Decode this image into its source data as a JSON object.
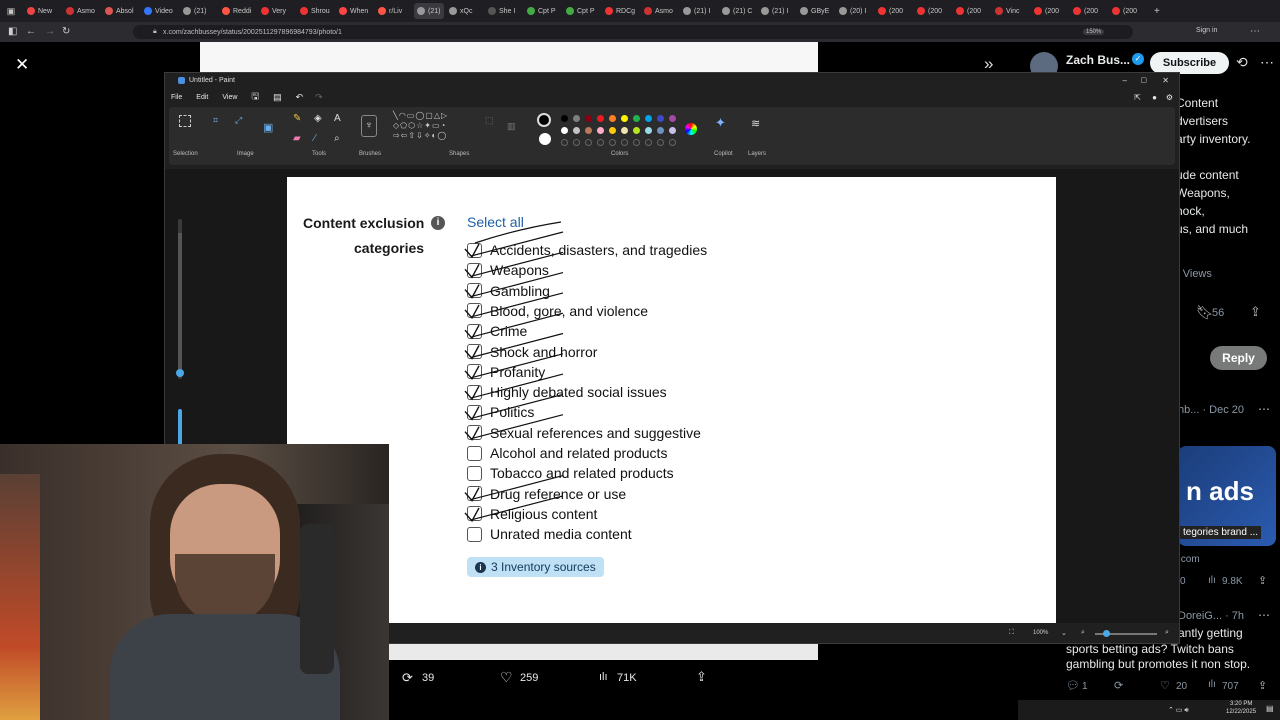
{
  "browser": {
    "tabs": [
      "New",
      "Asmo",
      "Absol",
      "Video",
      "(21)",
      "Reddi",
      "Very",
      "Shrou",
      "When",
      "r/Liv",
      "(21)",
      "xQc",
      "She I",
      "Cpt P",
      "Cpt P",
      "RDCg",
      "Asmo",
      "(21) I",
      "(21) C",
      "(21) I",
      "GByE",
      "(20) I",
      "(200",
      "(200",
      "(200",
      "Vinc",
      "(200",
      "(200",
      "(200"
    ],
    "url": "x.com/zachbussey/status/2002511297896984793/photo/1",
    "zoom": "150%",
    "sign_in": "Sign in"
  },
  "paint": {
    "title": "Untitled - Paint",
    "menu": [
      "File",
      "Edit",
      "View"
    ],
    "groups": [
      "Selection",
      "Image",
      "Tools",
      "Brushes",
      "Shapes",
      "Colors",
      "Copilot",
      "Layers"
    ],
    "zoom": "100%",
    "colors": [
      "#000000",
      "#7f7f7f",
      "#880015",
      "#ed1c24",
      "#ff7f27",
      "#fff200",
      "#22b14c",
      "#00a2e8",
      "#3f48cc",
      "#a349a4",
      "#ffffff",
      "#c3c3c3",
      "#b97a57",
      "#ffaec9",
      "#ffc90e",
      "#efe4b0",
      "#b5e61d",
      "#99d9ea",
      "#7092be",
      "#c8bfe7"
    ]
  },
  "form": {
    "title_line1": "Content exclusion",
    "title_line2": "categories",
    "info_icon": "i",
    "select_all": "Select all",
    "items": [
      {
        "label": "Accidents, disasters, and tragedies",
        "checked": true
      },
      {
        "label": "Weapons",
        "checked": true
      },
      {
        "label": "Gambling",
        "checked": true
      },
      {
        "label": "Blood, gore, and violence",
        "checked": true
      },
      {
        "label": "Crime",
        "checked": true
      },
      {
        "label": "Shock and horror",
        "checked": true
      },
      {
        "label": "Profanity",
        "checked": true
      },
      {
        "label": "Highly debated social issues",
        "checked": true
      },
      {
        "label": "Politics",
        "checked": true
      },
      {
        "label": "Sexual references and suggestive",
        "checked": true
      },
      {
        "label": "Alcohol and related products",
        "checked": false
      },
      {
        "label": "Tobacco and related products",
        "checked": false
      },
      {
        "label": "Drug reference or use",
        "checked": true
      },
      {
        "label": "Religious content",
        "checked": true
      },
      {
        "label": "Unrated media content",
        "checked": false
      }
    ],
    "inventory": "3 Inventory sources"
  },
  "twitter": {
    "author": "Zach Bus...",
    "subscribe": "Subscribe",
    "body_lines": [
      "Content",
      "dvertisers",
      "arty inventory.",
      "",
      "ude content",
      "Weapons,",
      "hock,",
      "us, and much"
    ],
    "views": "Views",
    "bookmarks": "56",
    "reply": "Reply",
    "reply_author": "hb... · Dec 20",
    "card_text": "n ads",
    "card_caption": "tegories brand ...",
    "card_domain": ".com",
    "card_stat_left": "0",
    "card_views": "9.8K",
    "reply2_author": "DoreiG... · 7h",
    "reply2_lines": [
      "antly getting",
      "sports betting ads? Twitch bans",
      "gambling but promotes it non stop."
    ],
    "reply2_stats": [
      "1",
      "",
      "20",
      "707"
    ],
    "main_stats": {
      "retweets": "39",
      "likes": "259",
      "views": "71K"
    }
  },
  "clock": {
    "time": "3:20 PM",
    "date": "12/22/2025"
  }
}
